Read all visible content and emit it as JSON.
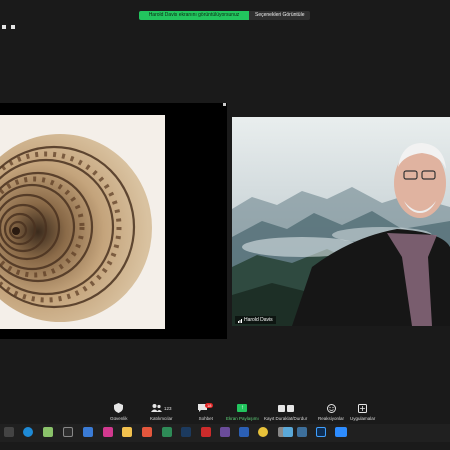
{
  "banner": {
    "sharing_text": "Harold Davis ekranını görüntülüyorsunuz",
    "view_options": "Seçenekleri Görüntüle"
  },
  "participant": {
    "name": "Harold Davis"
  },
  "toolbar": {
    "security": "Güvenlik",
    "participants": "Katılımcılar",
    "participants_count": "123",
    "chat": "Sohbet",
    "chat_badge": "18",
    "share_screen": "Ekran Paylaşımı",
    "record": "Kayıt Duraklat/Durdur",
    "reactions": "Reaksiyonlar",
    "apps": "Uygulamalar"
  },
  "colors": {
    "share_green": "#22c55e",
    "badge_red": "#e02424",
    "background": "#1a1a1a"
  },
  "taskbar_icons": [
    "task-view-icon",
    "edge-icon",
    "store-icon",
    "terminal-icon",
    "mail-icon",
    "photos-icon",
    "folder-icon",
    "pdf-icon",
    "excel-icon",
    "lightroom-icon",
    "acrobat-icon",
    "app-icon",
    "word-icon",
    "chrome-icon",
    "settings-icon",
    "media-icon",
    "network-icon",
    "photoshop-icon",
    "zoom-icon"
  ]
}
